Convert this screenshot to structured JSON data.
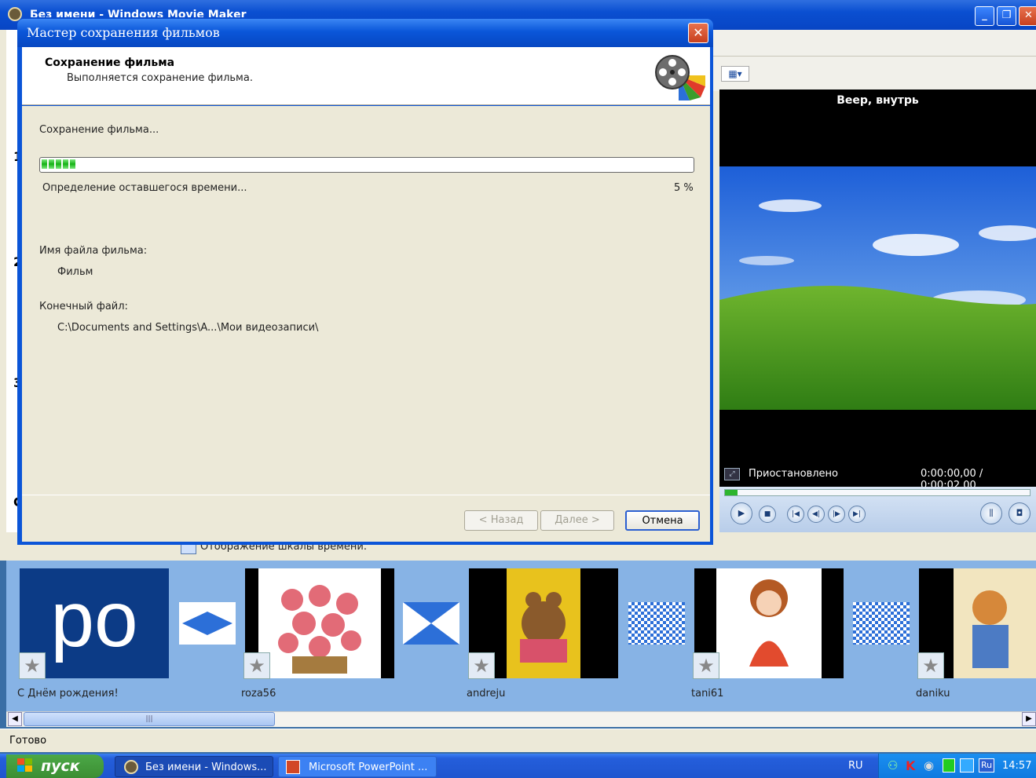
{
  "main_window": {
    "title": "Без имени - Windows Movie Maker",
    "minimize_label": "_",
    "restore_label": "❐",
    "close_label": "✕",
    "left_steps": [
      "1",
      "2",
      "3",
      "C"
    ]
  },
  "dialog": {
    "title": "Мастер сохранения фильмов",
    "close_label": "✕",
    "heading": "Сохранение фильма",
    "subheading": "Выполняется сохранение фильма.",
    "status": "Сохранение фильма...",
    "progress_percent": 5,
    "remaining_text": "Определение оставшегося времени...",
    "percent_label": "5 %",
    "filename_label": "Имя файла фильма:",
    "filename_value": "Фильм",
    "destination_label": "Конечный файл:",
    "destination_value": "C:\\Documents and Settings\\A...\\Мои видеозаписи\\",
    "buttons": {
      "back": "< Назад",
      "next": "Далее >",
      "cancel": "Отмена"
    }
  },
  "preview": {
    "title": "Веер, внутрь",
    "status": "Приостановлено",
    "time": "0:00:00,00 / 0:00:02,00",
    "seek_fraction": 0.0
  },
  "timeline_toolbar": {
    "label": "Отображение шкалы времени."
  },
  "storyboard": {
    "clips": [
      {
        "label": "С  Днём рождения!",
        "thumb_text": "po"
      },
      {
        "label": "roza56"
      },
      {
        "label": "andreju"
      },
      {
        "label": "tani61"
      },
      {
        "label": "daniku"
      }
    ]
  },
  "statusbar": {
    "text": "Готово"
  },
  "taskbar": {
    "start_label": "пуск",
    "tasks": [
      "Без имени - Windows...",
      "Microsoft PowerPoint ..."
    ],
    "lang": "RU",
    "tray_lang": "Ru",
    "clock": "14:57"
  },
  "colors": {
    "accent": "#0a56d9",
    "progress": "#15b215",
    "storyboard": "#87b3e5"
  }
}
